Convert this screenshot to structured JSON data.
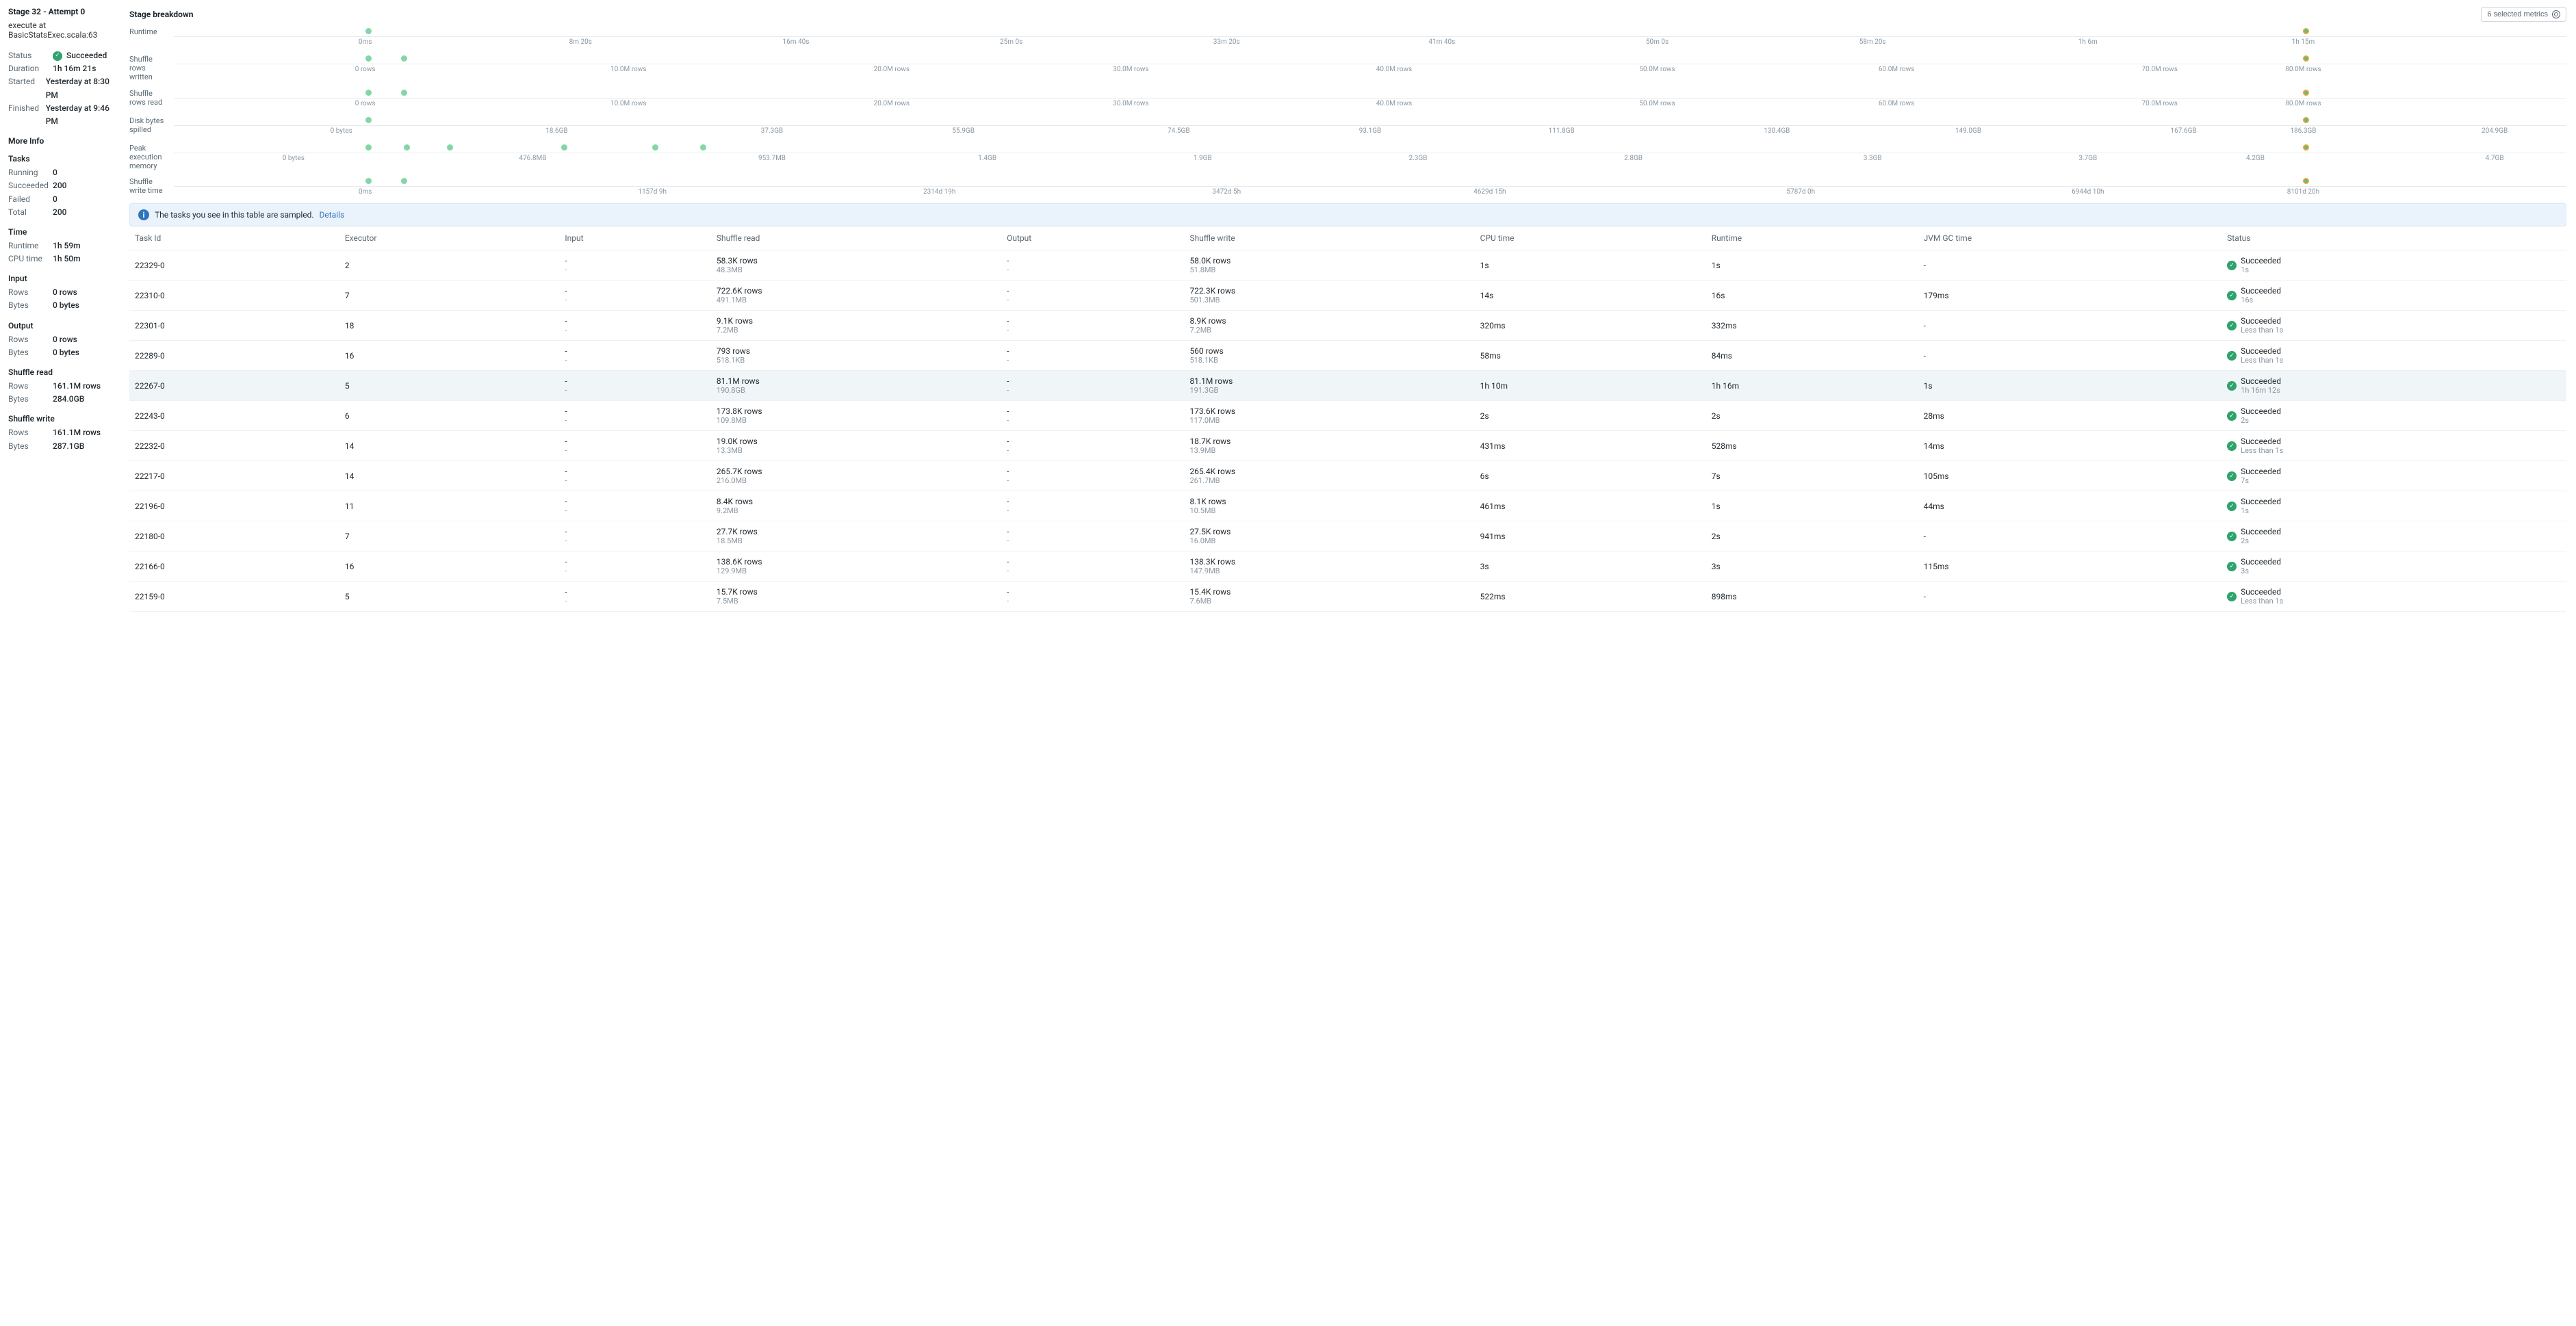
{
  "header": {
    "title": "Stage 32 - Attempt 0",
    "subtitle": "execute at BasicStatsExec.scala:63",
    "metrics_button": "6 selected metrics"
  },
  "overview": {
    "status_label": "Status",
    "status_value": "Succeeded",
    "duration_label": "Duration",
    "duration_value": "1h 16m 21s",
    "started_label": "Started",
    "started_value": "Yesterday at 8:30 PM",
    "finished_label": "Finished",
    "finished_value": "Yesterday at 9:46 PM"
  },
  "more_info": {
    "heading": "More Info",
    "tasks": {
      "heading": "Tasks",
      "running_label": "Running",
      "running_value": "0",
      "succeeded_label": "Succeeded",
      "succeeded_value": "200",
      "failed_label": "Failed",
      "failed_value": "0",
      "total_label": "Total",
      "total_value": "200"
    },
    "time": {
      "heading": "Time",
      "runtime_label": "Runtime",
      "runtime_value": "1h 59m",
      "cpu_label": "CPU time",
      "cpu_value": "1h 50m"
    },
    "input": {
      "heading": "Input",
      "rows_label": "Rows",
      "rows_value": "0 rows",
      "bytes_label": "Bytes",
      "bytes_value": "0 bytes"
    },
    "output": {
      "heading": "Output",
      "rows_label": "Rows",
      "rows_value": "0 rows",
      "bytes_label": "Bytes",
      "bytes_value": "0 bytes"
    },
    "shuffle_read": {
      "heading": "Shuffle read",
      "rows_label": "Rows",
      "rows_value": "161.1M rows",
      "bytes_label": "Bytes",
      "bytes_value": "284.0GB"
    },
    "shuffle_write": {
      "heading": "Shuffle write",
      "rows_label": "Rows",
      "rows_value": "161.1M rows",
      "bytes_label": "Bytes",
      "bytes_value": "287.1GB"
    }
  },
  "breakdown": {
    "heading": "Stage breakdown",
    "charts": [
      {
        "label": "Runtime",
        "ticks": [
          "0ms",
          "8m 20s",
          "16m 40s",
          "25m 0s",
          "33m 20s",
          "41m 40s",
          "50m 0s",
          "58m 20s",
          "1h 6m",
          "1h 15m"
        ],
        "tick_pcts": [
          8,
          17,
          26,
          35,
          44,
          53,
          62,
          71,
          80,
          89
        ],
        "dots": [
          {
            "pct": 8,
            "cls": "green"
          }
        ],
        "target_pct": 89
      },
      {
        "label": "Shuffle rows written",
        "ticks": [
          "0 rows",
          "10.0M rows",
          "20.0M rows",
          "30.0M rows",
          "40.0M rows",
          "50.0M rows",
          "60.0M rows",
          "70.0M rows",
          "80.0M rows"
        ],
        "tick_pcts": [
          8,
          19,
          30,
          40,
          51,
          62,
          72,
          83,
          89
        ],
        "dots": [
          {
            "pct": 8,
            "cls": "green"
          },
          {
            "pct": 9.5,
            "cls": "green"
          }
        ],
        "target_pct": 89
      },
      {
        "label": "Shuffle rows read",
        "ticks": [
          "0 rows",
          "10.0M rows",
          "20.0M rows",
          "30.0M rows",
          "40.0M rows",
          "50.0M rows",
          "60.0M rows",
          "70.0M rows",
          "80.0M rows"
        ],
        "tick_pcts": [
          8,
          19,
          30,
          40,
          51,
          62,
          72,
          83,
          89
        ],
        "dots": [
          {
            "pct": 8,
            "cls": "green"
          },
          {
            "pct": 9.5,
            "cls": "green"
          }
        ],
        "target_pct": 89
      },
      {
        "label": "Disk bytes spilled",
        "ticks": [
          "0 bytes",
          "18.6GB",
          "37.3GB",
          "55.9GB",
          "74.5GB",
          "93.1GB",
          "111.8GB",
          "130.4GB",
          "149.0GB",
          "167.6GB",
          "186.3GB",
          "204.9GB"
        ],
        "tick_pcts": [
          7,
          16,
          25,
          33,
          42,
          50,
          58,
          67,
          75,
          84,
          89,
          97
        ],
        "dots": [
          {
            "pct": 8,
            "cls": "green"
          }
        ],
        "target_pct": 89
      },
      {
        "label": "Peak execution memory",
        "ticks": [
          "0 bytes",
          "476.8MB",
          "953.7MB",
          "1.4GB",
          "1.9GB",
          "2.3GB",
          "2.8GB",
          "3.3GB",
          "3.7GB",
          "4.2GB",
          "4.7GB"
        ],
        "tick_pcts": [
          5,
          15,
          25,
          34,
          43,
          52,
          61,
          71,
          80,
          87,
          97
        ],
        "dots": [
          {
            "pct": 8,
            "cls": "green"
          },
          {
            "pct": 9.6,
            "cls": "green"
          },
          {
            "pct": 11.4,
            "cls": "green"
          },
          {
            "pct": 16.2,
            "cls": "green"
          },
          {
            "pct": 20,
            "cls": "green"
          },
          {
            "pct": 22,
            "cls": "green"
          }
        ],
        "target_pct": 89
      },
      {
        "label": "Shuffle write time",
        "ticks": [
          "0ms",
          "1157d 9h",
          "2314d 19h",
          "3472d 5h",
          "4629d 15h",
          "5787d 0h",
          "6944d 10h",
          "8101d 20h"
        ],
        "tick_pcts": [
          8,
          20,
          32,
          44,
          55,
          68,
          80,
          89
        ],
        "dots": [
          {
            "pct": 8,
            "cls": "green"
          },
          {
            "pct": 9.5,
            "cls": "green"
          }
        ],
        "target_pct": 89
      }
    ]
  },
  "banner": {
    "text": "The tasks you see in this table are sampled.",
    "link": "Details"
  },
  "table": {
    "headers": [
      "Task Id",
      "Executor",
      "Input",
      "Shuffle read",
      "Output",
      "Shuffle write",
      "CPU time",
      "Runtime",
      "JVM GC time",
      "Status"
    ],
    "rows": [
      {
        "id": "22329-0",
        "exec": "2",
        "in": "-",
        "in2": "-",
        "sr": "58.3K rows",
        "sr2": "48.3MB",
        "out": "-",
        "out2": "-",
        "sw": "58.0K rows",
        "sw2": "51.8MB",
        "cpu": "1s",
        "rt": "1s",
        "gc": "-",
        "st": "Succeeded",
        "st2": "1s"
      },
      {
        "id": "22310-0",
        "exec": "7",
        "in": "-",
        "in2": "-",
        "sr": "722.6K rows",
        "sr2": "491.1MB",
        "out": "-",
        "out2": "-",
        "sw": "722.3K rows",
        "sw2": "501.3MB",
        "cpu": "14s",
        "rt": "16s",
        "gc": "179ms",
        "st": "Succeeded",
        "st2": "16s"
      },
      {
        "id": "22301-0",
        "exec": "18",
        "in": "-",
        "in2": "-",
        "sr": "9.1K rows",
        "sr2": "7.2MB",
        "out": "-",
        "out2": "-",
        "sw": "8.9K rows",
        "sw2": "7.2MB",
        "cpu": "320ms",
        "rt": "332ms",
        "gc": "-",
        "st": "Succeeded",
        "st2": "Less than 1s"
      },
      {
        "id": "22289-0",
        "exec": "16",
        "in": "-",
        "in2": "-",
        "sr": "793 rows",
        "sr2": "518.1KB",
        "out": "-",
        "out2": "-",
        "sw": "560 rows",
        "sw2": "518.1KB",
        "cpu": "58ms",
        "rt": "84ms",
        "gc": "-",
        "st": "Succeeded",
        "st2": "Less than 1s"
      },
      {
        "id": "22267-0",
        "exec": "5",
        "in": "-",
        "in2": "-",
        "sr": "81.1M rows",
        "sr2": "190.8GB",
        "out": "-",
        "out2": "-",
        "sw": "81.1M rows",
        "sw2": "191.3GB",
        "cpu": "1h 10m",
        "rt": "1h 16m",
        "gc": "1s",
        "st": "Succeeded",
        "st2": "1h 16m 12s",
        "hl": true
      },
      {
        "id": "22243-0",
        "exec": "6",
        "in": "-",
        "in2": "-",
        "sr": "173.8K rows",
        "sr2": "109.8MB",
        "out": "-",
        "out2": "-",
        "sw": "173.6K rows",
        "sw2": "117.0MB",
        "cpu": "2s",
        "rt": "2s",
        "gc": "28ms",
        "st": "Succeeded",
        "st2": "2s"
      },
      {
        "id": "22232-0",
        "exec": "14",
        "in": "-",
        "in2": "-",
        "sr": "19.0K rows",
        "sr2": "13.3MB",
        "out": "-",
        "out2": "-",
        "sw": "18.7K rows",
        "sw2": "13.9MB",
        "cpu": "431ms",
        "rt": "528ms",
        "gc": "14ms",
        "st": "Succeeded",
        "st2": "Less than 1s"
      },
      {
        "id": "22217-0",
        "exec": "14",
        "in": "-",
        "in2": "-",
        "sr": "265.7K rows",
        "sr2": "216.0MB",
        "out": "-",
        "out2": "-",
        "sw": "265.4K rows",
        "sw2": "261.7MB",
        "cpu": "6s",
        "rt": "7s",
        "gc": "105ms",
        "st": "Succeeded",
        "st2": "7s"
      },
      {
        "id": "22196-0",
        "exec": "11",
        "in": "-",
        "in2": "-",
        "sr": "8.4K rows",
        "sr2": "9.2MB",
        "out": "-",
        "out2": "-",
        "sw": "8.1K rows",
        "sw2": "10.5MB",
        "cpu": "461ms",
        "rt": "1s",
        "gc": "44ms",
        "st": "Succeeded",
        "st2": "1s"
      },
      {
        "id": "22180-0",
        "exec": "7",
        "in": "-",
        "in2": "-",
        "sr": "27.7K rows",
        "sr2": "18.5MB",
        "out": "-",
        "out2": "-",
        "sw": "27.5K rows",
        "sw2": "16.0MB",
        "cpu": "941ms",
        "rt": "2s",
        "gc": "-",
        "st": "Succeeded",
        "st2": "2s"
      },
      {
        "id": "22166-0",
        "exec": "16",
        "in": "-",
        "in2": "-",
        "sr": "138.6K rows",
        "sr2": "129.9MB",
        "out": "-",
        "out2": "-",
        "sw": "138.3K rows",
        "sw2": "147.9MB",
        "cpu": "3s",
        "rt": "3s",
        "gc": "115ms",
        "st": "Succeeded",
        "st2": "3s"
      },
      {
        "id": "22159-0",
        "exec": "5",
        "in": "-",
        "in2": "-",
        "sr": "15.7K rows",
        "sr2": "7.5MB",
        "out": "-",
        "out2": "-",
        "sw": "15.4K rows",
        "sw2": "7.6MB",
        "cpu": "522ms",
        "rt": "898ms",
        "gc": "-",
        "st": "Succeeded",
        "st2": "Less than 1s"
      }
    ]
  },
  "chart_data": [
    {
      "type": "scatter",
      "title": "Runtime",
      "xlabel": "",
      "ylabel": "",
      "x": [
        "task-cluster",
        "selected-task"
      ],
      "values_approx": [
        "~0ms",
        "~1h 15m"
      ],
      "xlim": [
        "0ms",
        "1h 15m"
      ]
    },
    {
      "type": "scatter",
      "title": "Shuffle rows written",
      "xlabel": "",
      "ylabel": "",
      "x": [
        "task-cluster",
        "selected-task"
      ],
      "values_approx": [
        "~0 rows",
        "~80M rows"
      ],
      "xlim": [
        "0 rows",
        "80.0M rows"
      ]
    },
    {
      "type": "scatter",
      "title": "Shuffle rows read",
      "xlabel": "",
      "ylabel": "",
      "x": [
        "task-cluster",
        "selected-task"
      ],
      "values_approx": [
        "~0 rows",
        "~80M rows"
      ],
      "xlim": [
        "0 rows",
        "80.0M rows"
      ]
    },
    {
      "type": "scatter",
      "title": "Disk bytes spilled",
      "xlabel": "",
      "ylabel": "",
      "x": [
        "task-cluster",
        "selected-task"
      ],
      "values_approx": [
        "~0 bytes",
        "~186GB"
      ],
      "xlim": [
        "0 bytes",
        "204.9GB"
      ]
    },
    {
      "type": "scatter",
      "title": "Peak execution memory",
      "xlabel": "",
      "ylabel": "",
      "x": [
        "task-cluster-1",
        "task-cluster-2",
        "task-cluster-3",
        "task-cluster-4",
        "task-cluster-5",
        "task-cluster-6",
        "selected-task"
      ],
      "values_approx": [
        "~140MB",
        "~220MB",
        "~300MB",
        "~520MB",
        "~700MB",
        "~790MB",
        "~4.1GB"
      ],
      "xlim": [
        "0 bytes",
        "4.7GB"
      ]
    },
    {
      "type": "scatter",
      "title": "Shuffle write time",
      "xlabel": "",
      "ylabel": "",
      "x": [
        "task-cluster",
        "selected-task"
      ],
      "values_approx": [
        "~0ms",
        "~8101d 20h"
      ],
      "xlim": [
        "0ms",
        "8101d 20h"
      ]
    }
  ]
}
